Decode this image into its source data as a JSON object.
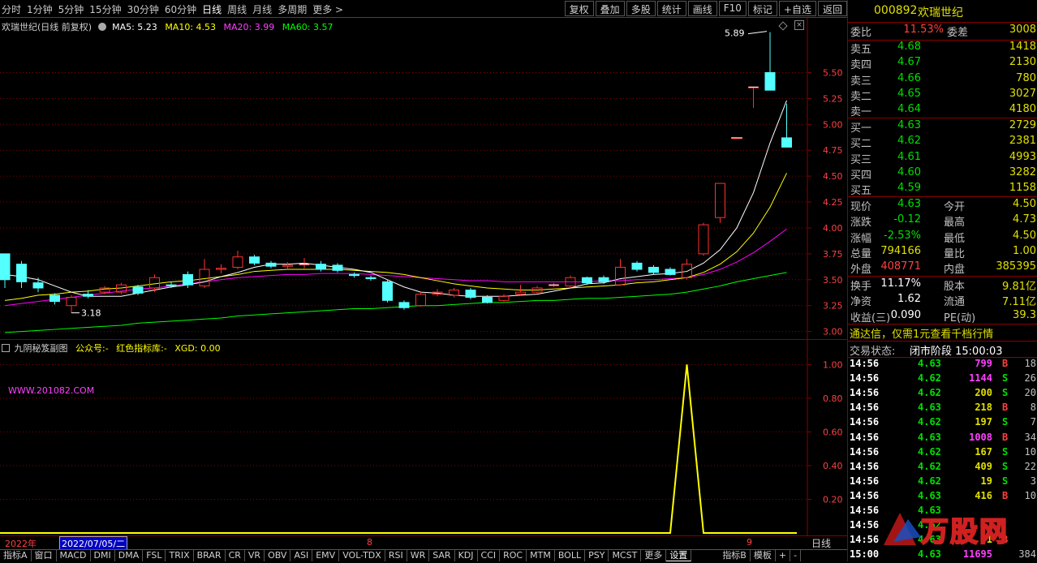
{
  "toolbar": {
    "periods": [
      "分时",
      "1分钟",
      "5分钟",
      "15分钟",
      "30分钟",
      "60分钟",
      "日线",
      "周线",
      "月线",
      "多周期",
      "更多 >"
    ],
    "buttons": [
      "复权",
      "叠加",
      "多股",
      "统计",
      "画线",
      "F10",
      "标记",
      "+自选",
      "返回"
    ]
  },
  "chart_header": {
    "title": "欢瑞世纪(日线 前复权)",
    "ma5": "MA5: 5.23",
    "ma10": "MA10: 4.53",
    "ma20": "MA20: 3.99",
    "ma60": "MA60: 3.57",
    "high_label": "5.89",
    "low_label": "3.18"
  },
  "colors": {
    "ma5": "#ffffff",
    "ma10": "#ffff00",
    "ma20": "#ff00ff",
    "ma60": "#00ff00",
    "up": "#ff3030",
    "down": "#54ffff",
    "grid": "#8b0000"
  },
  "chart_data": [
    {
      "type": "candlestick",
      "price_axis_ticks": [
        "5.50",
        "5.25",
        "5.00",
        "4.75",
        "4.50",
        "4.25",
        "4.00",
        "3.75",
        "3.50",
        "3.25",
        "3.00"
      ],
      "ylim": [
        2.95,
        5.95
      ],
      "candles": [
        {
          "o": 3.75,
          "c": 3.5,
          "h": 3.75,
          "l": 3.42
        },
        {
          "o": 3.65,
          "c": 3.48,
          "h": 3.68,
          "l": 3.42
        },
        {
          "o": 3.47,
          "c": 3.42,
          "h": 3.52,
          "l": 3.38
        },
        {
          "o": 3.35,
          "c": 3.29,
          "h": 3.37,
          "l": 3.26
        },
        {
          "o": 3.25,
          "c": 3.33,
          "h": 3.35,
          "l": 3.18
        },
        {
          "o": 3.36,
          "c": 3.34,
          "h": 3.4,
          "l": 3.32
        },
        {
          "o": 3.38,
          "c": 3.42,
          "h": 3.44,
          "l": 3.36
        },
        {
          "o": 3.38,
          "c": 3.45,
          "h": 3.47,
          "l": 3.36
        },
        {
          "o": 3.43,
          "c": 3.37,
          "h": 3.45,
          "l": 3.35
        },
        {
          "o": 3.42,
          "c": 3.52,
          "h": 3.55,
          "l": 3.38
        },
        {
          "o": 3.45,
          "c": 3.44,
          "h": 3.48,
          "l": 3.42
        },
        {
          "o": 3.55,
          "c": 3.45,
          "h": 3.58,
          "l": 3.42
        },
        {
          "o": 3.44,
          "c": 3.6,
          "h": 3.7,
          "l": 3.42
        },
        {
          "o": 3.6,
          "c": 3.61,
          "h": 3.65,
          "l": 3.56
        },
        {
          "o": 3.62,
          "c": 3.72,
          "h": 3.78,
          "l": 3.6
        },
        {
          "o": 3.72,
          "c": 3.66,
          "h": 3.74,
          "l": 3.64
        },
        {
          "o": 3.66,
          "c": 3.63,
          "h": 3.68,
          "l": 3.61
        },
        {
          "o": 3.63,
          "c": 3.64,
          "h": 3.67,
          "l": 3.6
        },
        {
          "o": 3.65,
          "c": 3.65,
          "h": 3.71,
          "l": 3.61
        },
        {
          "o": 3.65,
          "c": 3.6,
          "h": 3.68,
          "l": 3.58
        },
        {
          "o": 3.64,
          "c": 3.59,
          "h": 3.66,
          "l": 3.57
        },
        {
          "o": 3.55,
          "c": 3.54,
          "h": 3.57,
          "l": 3.52
        },
        {
          "o": 3.52,
          "c": 3.51,
          "h": 3.54,
          "l": 3.49
        },
        {
          "o": 3.48,
          "c": 3.3,
          "h": 3.5,
          "l": 3.28
        },
        {
          "o": 3.28,
          "c": 3.23,
          "h": 3.3,
          "l": 3.21
        },
        {
          "o": 3.25,
          "c": 3.36,
          "h": 3.38,
          "l": 3.24
        },
        {
          "o": 3.36,
          "c": 3.38,
          "h": 3.41,
          "l": 3.34
        },
        {
          "o": 3.35,
          "c": 3.4,
          "h": 3.42,
          "l": 3.33
        },
        {
          "o": 3.4,
          "c": 3.33,
          "h": 3.42,
          "l": 3.31
        },
        {
          "o": 3.33,
          "c": 3.28,
          "h": 3.35,
          "l": 3.27
        },
        {
          "o": 3.3,
          "c": 3.34,
          "h": 3.36,
          "l": 3.29
        },
        {
          "o": 3.36,
          "c": 3.38,
          "h": 3.45,
          "l": 3.35
        },
        {
          "o": 3.38,
          "c": 3.42,
          "h": 3.44,
          "l": 3.37
        },
        {
          "o": 3.45,
          "c": 3.45,
          "h": 3.47,
          "l": 3.43
        },
        {
          "o": 3.44,
          "c": 3.52,
          "h": 3.54,
          "l": 3.43
        },
        {
          "o": 3.52,
          "c": 3.47,
          "h": 3.53,
          "l": 3.45
        },
        {
          "o": 3.52,
          "c": 3.48,
          "h": 3.54,
          "l": 3.46
        },
        {
          "o": 3.45,
          "c": 3.62,
          "h": 3.7,
          "l": 3.44
        },
        {
          "o": 3.66,
          "c": 3.6,
          "h": 3.68,
          "l": 3.58
        },
        {
          "o": 3.62,
          "c": 3.57,
          "h": 3.64,
          "l": 3.55
        },
        {
          "o": 3.6,
          "c": 3.55,
          "h": 3.62,
          "l": 3.54
        },
        {
          "o": 3.52,
          "c": 3.65,
          "h": 3.7,
          "l": 3.5
        },
        {
          "o": 3.75,
          "c": 4.03,
          "h": 4.05,
          "l": 3.73
        },
        {
          "o": 4.1,
          "c": 4.43,
          "h": 4.43,
          "l": 4.05
        },
        {
          "o": 4.87,
          "c": 4.87,
          "h": 4.87,
          "l": 4.87
        },
        {
          "o": 5.36,
          "c": 5.36,
          "h": 5.36,
          "l": 5.16
        },
        {
          "o": 5.5,
          "c": 5.33,
          "h": 5.89,
          "l": 5.33
        },
        {
          "o": 4.87,
          "c": 4.78,
          "h": 5.2,
          "l": 4.78
        }
      ],
      "ma5": [
        3.55,
        3.53,
        3.5,
        3.44,
        3.38,
        3.34,
        3.34,
        3.34,
        3.37,
        3.4,
        3.43,
        3.45,
        3.48,
        3.53,
        3.57,
        3.62,
        3.65,
        3.65,
        3.66,
        3.64,
        3.62,
        3.6,
        3.57,
        3.5,
        3.43,
        3.38,
        3.37,
        3.35,
        3.34,
        3.34,
        3.34,
        3.35,
        3.36,
        3.39,
        3.42,
        3.46,
        3.47,
        3.51,
        3.53,
        3.55,
        3.56,
        3.58,
        3.66,
        3.79,
        4.0,
        4.34,
        4.82,
        5.23
      ],
      "ma10": [
        3.3,
        3.32,
        3.35,
        3.36,
        3.38,
        3.39,
        3.41,
        3.42,
        3.44,
        3.46,
        3.48,
        3.49,
        3.51,
        3.53,
        3.55,
        3.58,
        3.59,
        3.6,
        3.6,
        3.6,
        3.6,
        3.59,
        3.58,
        3.57,
        3.55,
        3.52,
        3.49,
        3.46,
        3.44,
        3.42,
        3.41,
        3.4,
        3.4,
        3.41,
        3.42,
        3.43,
        3.44,
        3.45,
        3.47,
        3.48,
        3.5,
        3.52,
        3.57,
        3.65,
        3.77,
        3.95,
        4.2,
        4.53
      ],
      "ma20": [
        3.25,
        3.27,
        3.29,
        3.31,
        3.33,
        3.35,
        3.37,
        3.39,
        3.41,
        3.42,
        3.44,
        3.46,
        3.48,
        3.5,
        3.52,
        3.53,
        3.54,
        3.55,
        3.55,
        3.56,
        3.56,
        3.56,
        3.55,
        3.54,
        3.53,
        3.52,
        3.51,
        3.5,
        3.49,
        3.49,
        3.48,
        3.48,
        3.48,
        3.48,
        3.48,
        3.48,
        3.49,
        3.49,
        3.5,
        3.5,
        3.51,
        3.52,
        3.55,
        3.6,
        3.67,
        3.76,
        3.87,
        3.99
      ],
      "ma60": [
        2.99,
        3.0,
        3.01,
        3.02,
        3.03,
        3.04,
        3.05,
        3.06,
        3.08,
        3.09,
        3.1,
        3.11,
        3.12,
        3.13,
        3.15,
        3.16,
        3.17,
        3.18,
        3.19,
        3.2,
        3.21,
        3.22,
        3.22,
        3.23,
        3.24,
        3.25,
        3.25,
        3.26,
        3.27,
        3.28,
        3.28,
        3.29,
        3.3,
        3.3,
        3.31,
        3.32,
        3.32,
        3.33,
        3.34,
        3.35,
        3.36,
        3.38,
        3.41,
        3.44,
        3.48,
        3.51,
        3.54,
        3.57
      ]
    },
    {
      "type": "line",
      "series_name": "XGD",
      "ylim": [
        0,
        1.05
      ],
      "y_axis_ticks": [
        "1.00",
        "0.80",
        "0.60",
        "0.40",
        "0.20"
      ],
      "values": [
        0,
        0,
        0,
        0,
        0,
        0,
        0,
        0,
        0,
        0,
        0,
        0,
        0,
        0,
        0,
        0,
        0,
        0,
        0,
        0,
        0,
        0,
        0,
        0,
        0,
        0,
        0,
        0,
        0,
        0,
        0,
        0,
        0,
        0,
        0,
        0,
        0,
        0,
        0,
        0,
        0,
        1,
        0,
        0,
        0,
        0,
        0,
        0
      ]
    }
  ],
  "sub_header": {
    "title": "九阴秘笈副图",
    "gzh": "公众号:-",
    "lib": "红色指标库:-",
    "xgd": "XGD: 0.00",
    "watermark": "WWW.201082.COM"
  },
  "time_axis": {
    "year": "2022年",
    "date": "2022/07/05/二",
    "m8": "8",
    "m9": "9",
    "period": "日线"
  },
  "bottom_tabs": [
    "指标A",
    "窗口",
    "MACD",
    "DMI",
    "DMA",
    "FSL",
    "TRIX",
    "BRAR",
    "CR",
    "VR",
    "OBV",
    "ASI",
    "EMV",
    "VOL-TDX",
    "RSI",
    "WR",
    "SAR",
    "KDJ",
    "CCI",
    "ROC",
    "MTM",
    "BOLL",
    "PSY",
    "MCST",
    "更多",
    "设置",
    "指标B",
    "模板",
    "+",
    "-"
  ],
  "quote": {
    "code": "000892",
    "name": "欢瑞世纪",
    "weibi_label": "委比",
    "weibi": "11.53%",
    "weicha_label": "委差",
    "weicha": "3008",
    "asks": [
      {
        "label": "卖五",
        "price": "4.68",
        "vol": "1418"
      },
      {
        "label": "卖四",
        "price": "4.67",
        "vol": "2130"
      },
      {
        "label": "卖三",
        "price": "4.66",
        "vol": "780"
      },
      {
        "label": "卖二",
        "price": "4.65",
        "vol": "3027"
      },
      {
        "label": "卖一",
        "price": "4.64",
        "vol": "4180"
      }
    ],
    "bids": [
      {
        "label": "买一",
        "price": "4.63",
        "vol": "2729"
      },
      {
        "label": "买二",
        "price": "4.62",
        "vol": "2381"
      },
      {
        "label": "买三",
        "price": "4.61",
        "vol": "4993"
      },
      {
        "label": "买四",
        "price": "4.60",
        "vol": "3282"
      },
      {
        "label": "买五",
        "price": "4.59",
        "vol": "1158"
      }
    ],
    "stats": [
      {
        "l1": "现价",
        "v1": "4.63",
        "c1": "green",
        "l2": "今开",
        "v2": "4.50",
        "c2": "green"
      },
      {
        "l1": "涨跌",
        "v1": "-0.12",
        "c1": "green",
        "l2": "最高",
        "v2": "4.73",
        "c2": "green"
      },
      {
        "l1": "涨幅",
        "v1": "-2.53%",
        "c1": "green",
        "l2": "最低",
        "v2": "4.50",
        "c2": "green"
      },
      {
        "l1": "总量",
        "v1": "794166",
        "c1": "yellow",
        "l2": "量比",
        "v2": "1.00",
        "c2": "yellow"
      },
      {
        "l1": "外盘",
        "v1": "408771",
        "c1": "red",
        "l2": "内盘",
        "v2": "385395",
        "c2": "green"
      }
    ],
    "stats2": [
      {
        "l1": "换手",
        "v1": "11.17%",
        "l2": "股本",
        "v2": "9.81亿"
      },
      {
        "l1": "净资",
        "v1": "1.62",
        "l2": "流通",
        "v2": "7.11亿"
      },
      {
        "l1": "收益(三)",
        "v1": "0.090",
        "l2": "PE(动)",
        "v2": "39.3"
      }
    ],
    "ad": "通达信，仅需1元查看千档行情",
    "trade_status_label": "交易状态:",
    "trade_status": "闭市阶段 15:00:03",
    "ticks": [
      {
        "t": "14:56",
        "p": "4.63",
        "v": "799",
        "s": "B",
        "n": "18"
      },
      {
        "t": "14:56",
        "p": "4.62",
        "v": "1144",
        "s": "S",
        "n": "26"
      },
      {
        "t": "14:56",
        "p": "4.62",
        "v": "200",
        "s": "S",
        "n": "20"
      },
      {
        "t": "14:56",
        "p": "4.63",
        "v": "218",
        "s": "B",
        "n": "8"
      },
      {
        "t": "14:56",
        "p": "4.62",
        "v": "197",
        "s": "S",
        "n": "7"
      },
      {
        "t": "14:56",
        "p": "4.63",
        "v": "1008",
        "s": "B",
        "n": "34"
      },
      {
        "t": "14:56",
        "p": "4.62",
        "v": "167",
        "s": "S",
        "n": "10"
      },
      {
        "t": "14:56",
        "p": "4.62",
        "v": "409",
        "s": "S",
        "n": "22"
      },
      {
        "t": "14:56",
        "p": "4.62",
        "v": "19",
        "s": "S",
        "n": "3"
      },
      {
        "t": "14:56",
        "p": "4.63",
        "v": "416",
        "s": "B",
        "n": "10"
      },
      {
        "t": "14:56",
        "p": "4.63",
        "v": "",
        "s": "",
        "n": ""
      },
      {
        "t": "14:56",
        "p": "4.62",
        "v": "",
        "s": "",
        "n": ""
      },
      {
        "t": "14:56",
        "p": "4.63",
        "v": "41",
        "s": "B",
        "n": ""
      },
      {
        "t": "15:00",
        "p": "4.63",
        "v": "11695",
        "s": "",
        "n": "384"
      }
    ],
    "logo_text": "万股网"
  }
}
